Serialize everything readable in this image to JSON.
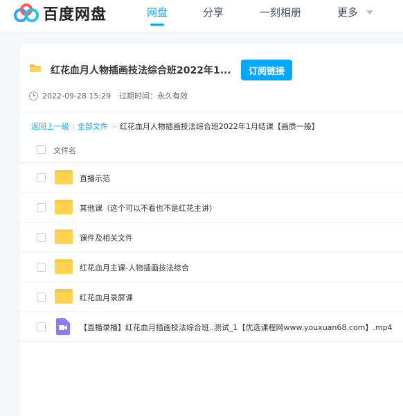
{
  "brand": {
    "name": "百度网盘"
  },
  "nav": {
    "items": [
      {
        "label": "网盘",
        "active": true
      },
      {
        "label": "分享",
        "active": false
      },
      {
        "label": "一刻相册",
        "active": false
      },
      {
        "label": "更多",
        "active": false
      }
    ]
  },
  "share": {
    "title": "红花血月人物插画技法综合班2022年1...",
    "subscribe_label": "订阅链接",
    "date": "2022-09-28 15:29",
    "expire_label": "过期时间：永久有效"
  },
  "breadcrumb": {
    "back": "返回上一级",
    "sep1": "|",
    "all_files": "全部文件",
    "sep2": ">",
    "current": "红花血月人物插画技法综合班2022年1月结课【画质一般】"
  },
  "list": {
    "header": "文件名",
    "rows": [
      {
        "name": "直播示范",
        "type": "folder"
      },
      {
        "name": "其他课（这个可以不看也不是红花主讲）",
        "type": "folder"
      },
      {
        "name": "课件及相关文件",
        "type": "folder"
      },
      {
        "name": "红花血月主课-人物插画技法综合",
        "type": "folder"
      },
      {
        "name": "红花血月录屏课",
        "type": "folder"
      },
      {
        "name": "【直播录播】红花血月插画技法综合班..测试_1【优选课程网www.youxuan68.com】.mp4",
        "type": "video"
      }
    ]
  },
  "colors": {
    "accent": "#06a7ff",
    "folder": "#ffd24f",
    "video": "#8a7cf6"
  }
}
